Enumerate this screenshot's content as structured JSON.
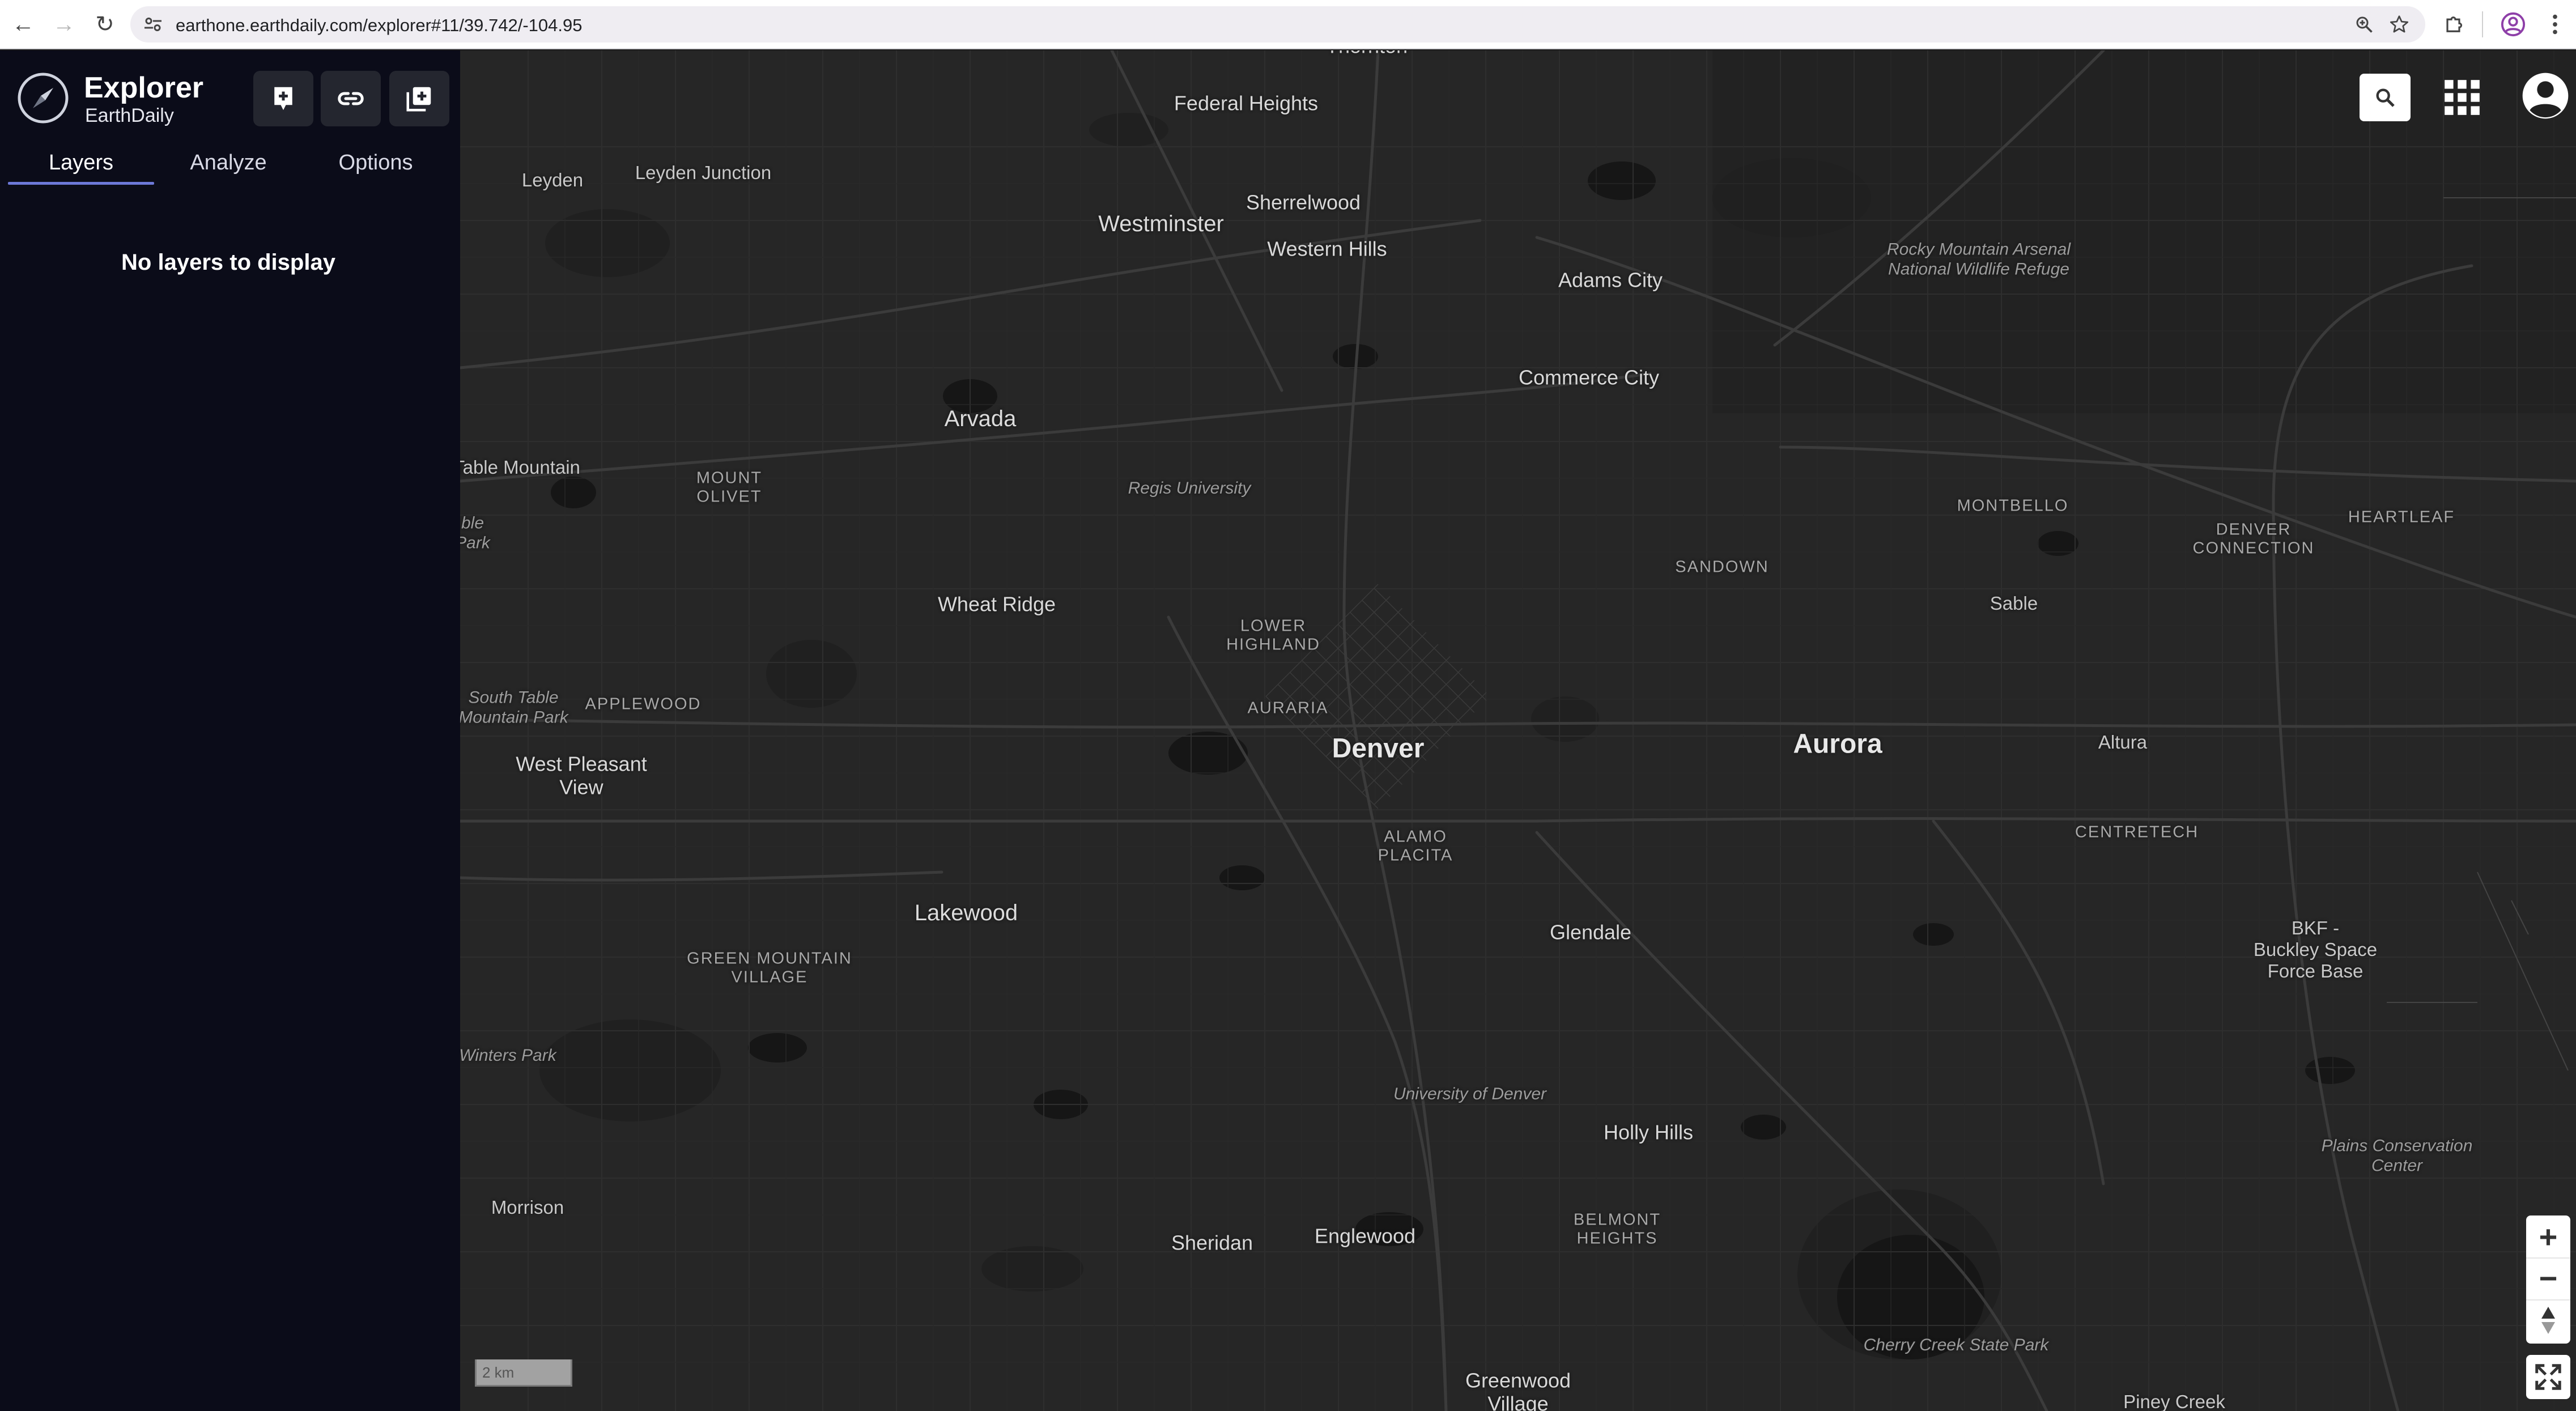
{
  "browser": {
    "url": "earthone.earthdaily.com/explorer#11/39.742/-104.95",
    "icons": {
      "back": "back-arrow-icon",
      "forward": "forward-arrow-icon",
      "reload": "reload-icon",
      "site_info": "tune-icon",
      "zoom": "zoom-icon",
      "bookmark": "star-icon",
      "extensions": "puzzle-icon",
      "profile": "profile-icon",
      "menu": "kebab-menu-icon"
    },
    "glyphs": {
      "back": "←",
      "forward": "→",
      "reload": "↻"
    }
  },
  "app": {
    "title": "Explorer",
    "subtitle": "EarthDaily",
    "logo": "compass-icon",
    "toolbar": [
      "add-marker-icon",
      "link-icon",
      "add-layer-icon"
    ]
  },
  "tabs": [
    {
      "label": "Layers",
      "active": true
    },
    {
      "label": "Analyze",
      "active": false
    },
    {
      "label": "Options",
      "active": false
    }
  ],
  "layers_panel": {
    "empty_message": "No layers to display"
  },
  "map": {
    "scale_label": "2 km",
    "controls": {
      "zoom_in": "+",
      "zoom_out": "−",
      "icons": [
        "search-icon",
        "apps-grid-icon",
        "account-icon",
        "compass-arrow-icon",
        "fullscreen-icon"
      ]
    },
    "labels": [
      {
        "text": "Thornton",
        "cls": "city"
      },
      {
        "text": "Federal Heights",
        "cls": "city"
      },
      {
        "text": "Leyden",
        "cls": "town"
      },
      {
        "text": "Leyden Junction",
        "cls": "town"
      },
      {
        "text": "Westminster",
        "cls": "med"
      },
      {
        "text": "Sherrelwood",
        "cls": "city"
      },
      {
        "text": "Western Hills",
        "cls": "city"
      },
      {
        "text": "Adams City",
        "cls": "city"
      },
      {
        "text": "Rocky Mountain Arsenal\nNational Wildlife Refuge",
        "cls": "italic"
      },
      {
        "text": "Commerce City",
        "cls": "city"
      },
      {
        "text": "Arvada",
        "cls": "med"
      },
      {
        "text": "Table Mountain",
        "cls": "town"
      },
      {
        "text": "MOUNT\nOLIVET",
        "cls": "small"
      },
      {
        "text": "ble\nPark",
        "cls": "italic"
      },
      {
        "text": "Regis University",
        "cls": "italic"
      },
      {
        "text": "MONTBELLO",
        "cls": "small"
      },
      {
        "text": "DENVER\nCONNECTION",
        "cls": "small"
      },
      {
        "text": "HEARTLEAF",
        "cls": "small"
      },
      {
        "text": "SANDOWN",
        "cls": "small"
      },
      {
        "text": "Sable",
        "cls": "town"
      },
      {
        "text": "Wheat Ridge",
        "cls": "city"
      },
      {
        "text": "LOWER\nHIGHLAND",
        "cls": "small"
      },
      {
        "text": "South Table\nMountain Park",
        "cls": "italic"
      },
      {
        "text": "APPLEWOOD",
        "cls": "small"
      },
      {
        "text": "AURARIA",
        "cls": "small"
      },
      {
        "text": "Denver",
        "cls": "big"
      },
      {
        "text": "Aurora",
        "cls": "big"
      },
      {
        "text": "Altura",
        "cls": "town"
      },
      {
        "text": "West Pleasant\nView",
        "cls": "city"
      },
      {
        "text": "ALAMO\nPLACITA",
        "cls": "small"
      },
      {
        "text": "CENTRETECH",
        "cls": "small"
      },
      {
        "text": "Lakewood",
        "cls": "med"
      },
      {
        "text": "Glendale",
        "cls": "city"
      },
      {
        "text": "GREEN MOUNTAIN\nVILLAGE",
        "cls": "small"
      },
      {
        "text": "BKF -\nBuckley Space\nForce Base",
        "cls": "town"
      },
      {
        "text": "Winters Park",
        "cls": "italic"
      },
      {
        "text": "University of Denver",
        "cls": "italic"
      },
      {
        "text": "Holly Hills",
        "cls": "city"
      },
      {
        "text": "Plains Conservation\nCenter",
        "cls": "italic"
      },
      {
        "text": "Morrison",
        "cls": "town"
      },
      {
        "text": "BELMONT\nHEIGHTS",
        "cls": "small"
      },
      {
        "text": "Sheridan",
        "cls": "city"
      },
      {
        "text": "Englewood",
        "cls": "city"
      },
      {
        "text": "Cherry Creek State Park",
        "cls": "italic"
      },
      {
        "text": "Greenwood\nVillage",
        "cls": "city"
      },
      {
        "text": "Piney Creek",
        "cls": "town"
      }
    ]
  }
}
